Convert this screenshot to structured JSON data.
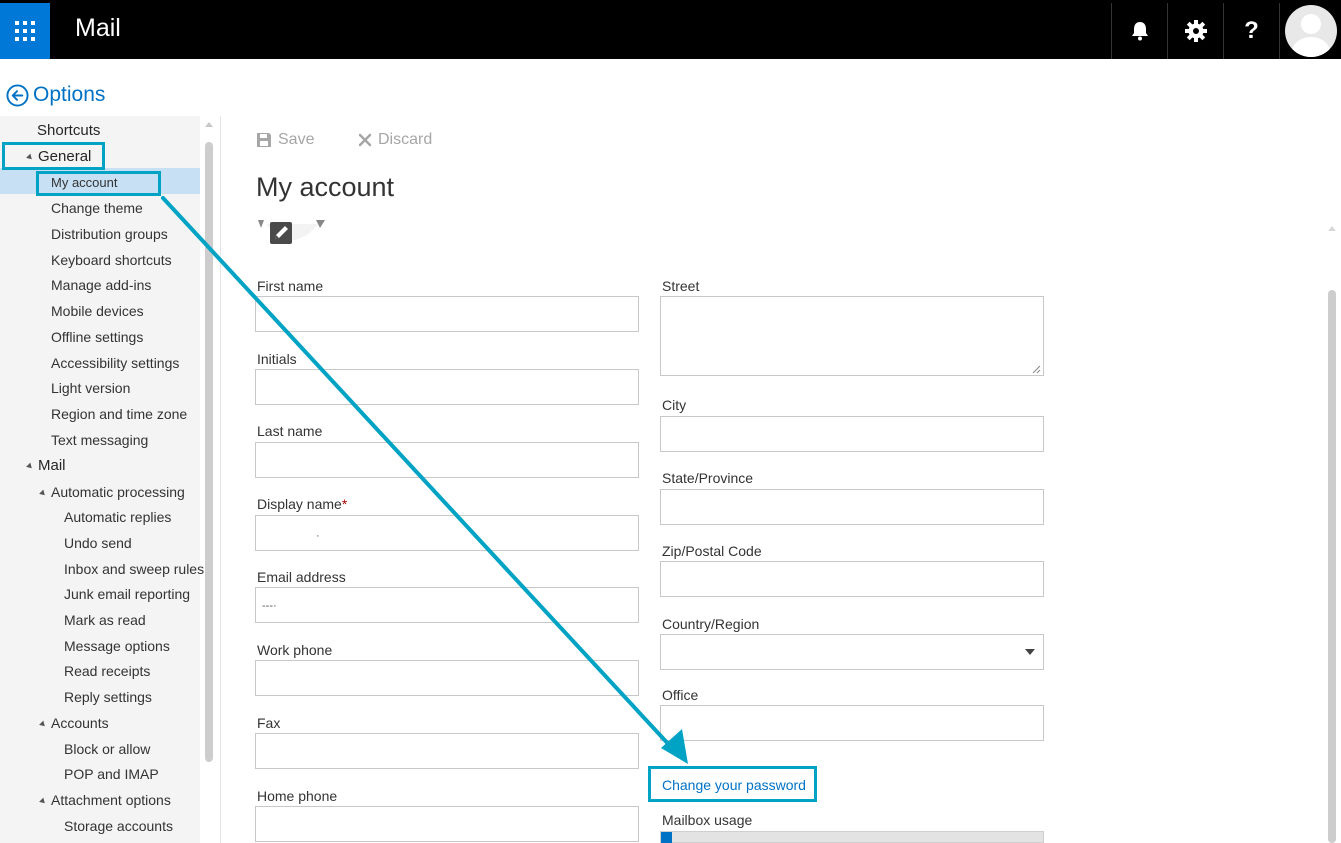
{
  "header": {
    "app_title": "Mail",
    "icons": [
      "app-launcher-icon",
      "bell-icon",
      "gear-icon",
      "help-icon",
      "avatar"
    ]
  },
  "options": {
    "back_label": "Options"
  },
  "nav": {
    "items": [
      {
        "label": "Shortcuts",
        "level": 0
      },
      {
        "label": "General",
        "level": 0,
        "expanded": true
      },
      {
        "label": "My account",
        "level": 1,
        "selected": true
      },
      {
        "label": "Change theme",
        "level": 1
      },
      {
        "label": "Distribution groups",
        "level": 1
      },
      {
        "label": "Keyboard shortcuts",
        "level": 1
      },
      {
        "label": "Manage add-ins",
        "level": 1
      },
      {
        "label": "Mobile devices",
        "level": 1
      },
      {
        "label": "Offline settings",
        "level": 1
      },
      {
        "label": "Accessibility settings",
        "level": 1
      },
      {
        "label": "Light version",
        "level": 1
      },
      {
        "label": "Region and time zone",
        "level": 1
      },
      {
        "label": "Text messaging",
        "level": 1
      },
      {
        "label": "Mail",
        "level": 0,
        "expanded": true
      },
      {
        "label": "Automatic processing",
        "level": 1,
        "expanded": true
      },
      {
        "label": "Automatic replies",
        "level": 2
      },
      {
        "label": "Undo send",
        "level": 2
      },
      {
        "label": "Inbox and sweep rules",
        "level": 2
      },
      {
        "label": "Junk email reporting",
        "level": 2
      },
      {
        "label": "Mark as read",
        "level": 2
      },
      {
        "label": "Message options",
        "level": 2
      },
      {
        "label": "Read receipts",
        "level": 2
      },
      {
        "label": "Reply settings",
        "level": 2
      },
      {
        "label": "Accounts",
        "level": 1,
        "expanded": true
      },
      {
        "label": "Block or allow",
        "level": 2
      },
      {
        "label": "POP and IMAP",
        "level": 2
      },
      {
        "label": "Attachment options",
        "level": 1,
        "expanded": true
      },
      {
        "label": "Storage accounts",
        "level": 2
      }
    ]
  },
  "toolbar": {
    "save_label": "Save",
    "discard_label": "Discard"
  },
  "page": {
    "title": "My account"
  },
  "form": {
    "first_name": {
      "label": "First name",
      "value": ""
    },
    "initials": {
      "label": "Initials",
      "value": ""
    },
    "last_name": {
      "label": "Last name",
      "value": ""
    },
    "display_name": {
      "label": "Display name",
      "required_mark": "*",
      "value": "·"
    },
    "email": {
      "label": "Email address",
      "value": "---·"
    },
    "work_phone": {
      "label": "Work phone",
      "value": ""
    },
    "fax": {
      "label": "Fax",
      "value": ""
    },
    "home_phone": {
      "label": "Home phone",
      "value": ""
    },
    "street": {
      "label": "Street",
      "value": ""
    },
    "city": {
      "label": "City",
      "value": ""
    },
    "state": {
      "label": "State/Province",
      "value": ""
    },
    "zip": {
      "label": "Zip/Postal Code",
      "value": ""
    },
    "country": {
      "label": "Country/Region",
      "value": ""
    },
    "office": {
      "label": "Office",
      "value": ""
    }
  },
  "links": {
    "change_password": "Change your password"
  },
  "mailbox": {
    "label": "Mailbox usage",
    "usage_fraction": 0.03
  },
  "colors": {
    "accent": "#0072c6",
    "launcher": "#0078d7",
    "annotation": "#00a3c4",
    "selected_nav": "#c7e0f4"
  }
}
